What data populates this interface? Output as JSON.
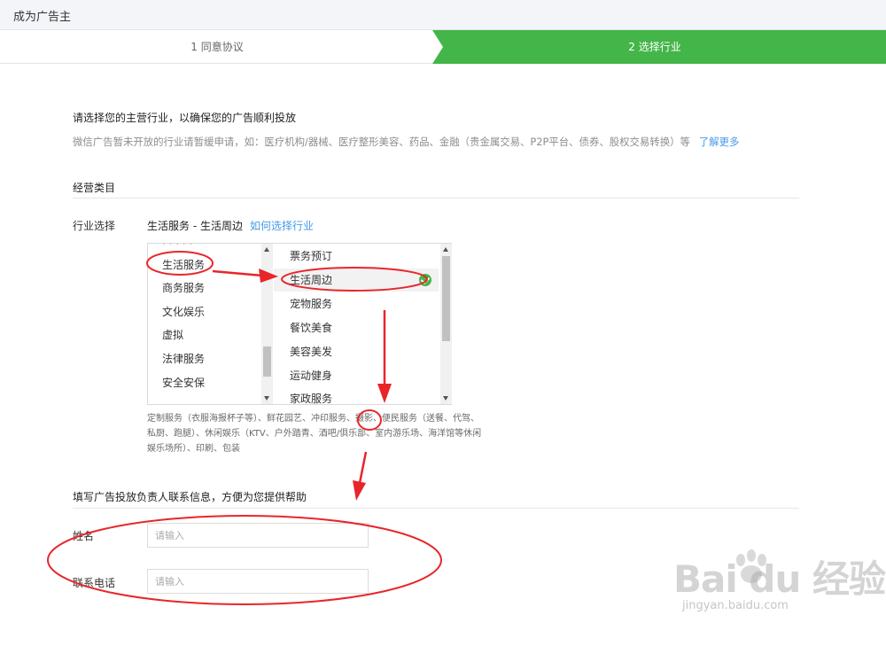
{
  "header": {
    "title": "成为广告主"
  },
  "steps": [
    {
      "label": "1 同意协议",
      "active": false
    },
    {
      "label": "2 选择行业",
      "active": true
    }
  ],
  "intro": {
    "lead": "请选择您的主营行业，以确保您的广告顺利投放",
    "note": "微信广告暂未开放的行业请暂缓申请，如：医疗机构/器械、医疗整形美容、药品、金融（贵金属交易、P2P平台、债券、股权交易转换）等",
    "learn_more": "了解更多"
  },
  "category_section": {
    "title": "经营类目",
    "industry_label": "行业选择",
    "industry_value": "生活服务 - 生活周边",
    "how_to_link": "如何选择行业",
    "primary_options": [
      "生活服务",
      "商务服务",
      "文化娱乐",
      "虚拟",
      "法律服务",
      "安全安保"
    ],
    "secondary_options": [
      "票务预订",
      "生活周边",
      "宠物服务",
      "餐饮美食",
      "美容美发",
      "运动健身",
      "家政服务"
    ],
    "selected_primary": "生活服务",
    "selected_secondary": "生活周边",
    "example_text": "定制服务（衣服海报杯子等）、鲜花园艺、冲印服务、摄影、便民服务（送餐、代驾、私厨、跑腿）、休闲娱乐（KTV、户外踏青、酒吧/俱乐部、室内游乐场、海洋馆等休闲娱乐场所）、印刷、包装"
  },
  "contact_section": {
    "title": "填写广告投放负责人联系信息，方便为您提供帮助",
    "name_label": "姓名",
    "name_placeholder": "请输入",
    "phone_label": "联系电话",
    "phone_placeholder": "请输入"
  },
  "watermark": {
    "brand": "Bai du 经验",
    "url": "jingyan.baidu.com"
  },
  "colors": {
    "accent_green": "#44b549",
    "link_blue": "#459ae9",
    "annotation_red": "#e8262a"
  }
}
